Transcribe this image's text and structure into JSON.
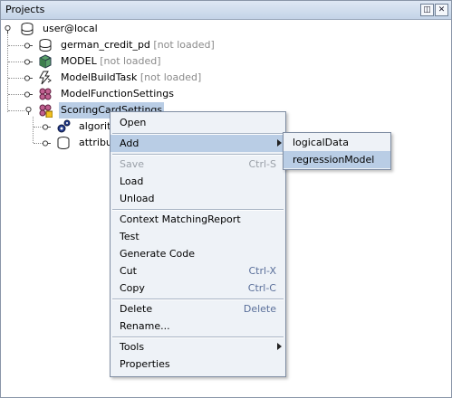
{
  "panel": {
    "title": "Projects"
  },
  "titlebar_buttons": {
    "restore": "◫",
    "close": "✕"
  },
  "tree": {
    "root": {
      "label": "user@local",
      "icon": "database-icon"
    },
    "items": [
      {
        "label": "german_credit_pd",
        "status": "[not loaded]",
        "icon": "database-icon"
      },
      {
        "label": "MODEL",
        "status": "[not loaded]",
        "icon": "model-cube-icon"
      },
      {
        "label": "ModelBuildTask",
        "status": "[not loaded]",
        "icon": "build-task-icon"
      },
      {
        "label": "ModelFunctionSettings",
        "status": "",
        "icon": "function-settings-icon"
      },
      {
        "label": "ScoringCardSettings",
        "status": "",
        "icon": "scoring-card-icon"
      },
      {
        "label": "algorit",
        "status": "",
        "icon": "algorithm-gear-icon"
      },
      {
        "label": "attribu",
        "status": "",
        "icon": "attribute-cylinder-icon"
      }
    ]
  },
  "context_menu": {
    "items": [
      {
        "label": "Open",
        "shortcut": "",
        "disabled": false
      },
      {
        "label": "Add",
        "shortcut": "",
        "disabled": false,
        "submenu": true
      },
      {
        "label": "Save",
        "shortcut": "Ctrl-S",
        "disabled": true
      },
      {
        "label": "Load",
        "shortcut": "",
        "disabled": false
      },
      {
        "label": "Unload",
        "shortcut": "",
        "disabled": false
      },
      {
        "label": "Context MatchingReport",
        "shortcut": "",
        "disabled": false
      },
      {
        "label": "Test",
        "shortcut": "",
        "disabled": false
      },
      {
        "label": "Generate Code",
        "shortcut": "",
        "disabled": false
      },
      {
        "label": "Cut",
        "shortcut": "Ctrl-X",
        "disabled": false
      },
      {
        "label": "Copy",
        "shortcut": "Ctrl-C",
        "disabled": false
      },
      {
        "label": "Delete",
        "shortcut": "Delete",
        "disabled": false
      },
      {
        "label": "Rename...",
        "shortcut": "",
        "disabled": false
      },
      {
        "label": "Tools",
        "shortcut": "",
        "disabled": false,
        "submenu": true
      },
      {
        "label": "Properties",
        "shortcut": "",
        "disabled": false
      }
    ]
  },
  "submenu": {
    "items": [
      {
        "label": "logicalData"
      },
      {
        "label": "regressionModel",
        "selected": true
      }
    ]
  }
}
